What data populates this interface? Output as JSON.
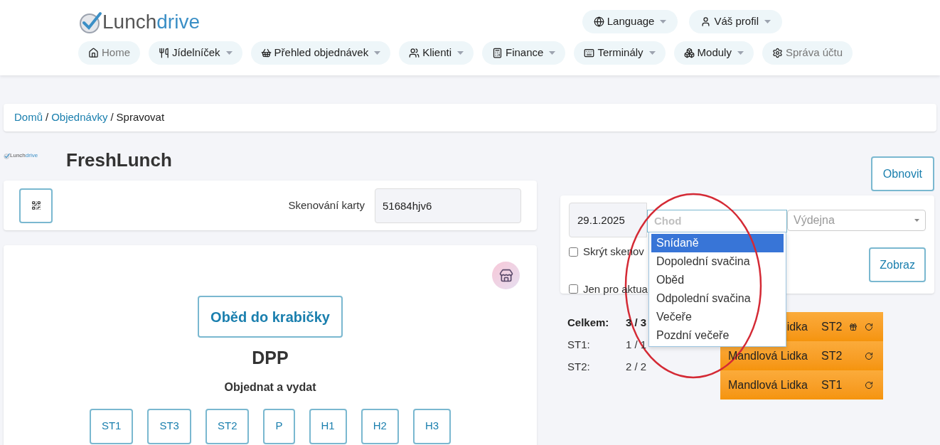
{
  "brand": {
    "part_1": "Lunch",
    "part_2": "drive"
  },
  "top_menu": [
    {
      "label": "Language"
    },
    {
      "label": "Váš profil"
    }
  ],
  "nav": [
    {
      "label": "Home",
      "dropdown": false,
      "muted": true
    },
    {
      "label": "Jídelníček",
      "dropdown": true,
      "muted": false
    },
    {
      "label": "Přehled objednávek",
      "dropdown": true,
      "muted": false
    },
    {
      "label": "Klienti",
      "dropdown": true,
      "muted": false
    },
    {
      "label": "Finance",
      "dropdown": true,
      "muted": false
    },
    {
      "label": "Terminály",
      "dropdown": true,
      "muted": false
    },
    {
      "label": "Moduly",
      "dropdown": true,
      "muted": false
    },
    {
      "label": "Správa účtu",
      "dropdown": false,
      "muted": true
    }
  ],
  "breadcrumb": {
    "separator": "/",
    "items": [
      {
        "label": "Domů",
        "link": true
      },
      {
        "label": "Objednávky",
        "link": true
      },
      {
        "label": "Spravovat",
        "link": false
      }
    ]
  },
  "small_brand": {
    "part_1": "Lunch",
    "part_2": "drive"
  },
  "page_title": "FreshLunch",
  "scan": {
    "label": "Skenování karty",
    "value": "51684hjv6"
  },
  "meal_card": {
    "box_button": "Oběd do krabičky",
    "title": "DPP",
    "subtitle": "Objednat a vydat",
    "stations": [
      "ST1",
      "ST3",
      "ST2",
      "P",
      "H1",
      "H2",
      "H3"
    ]
  },
  "refresh_button": "Obnovit",
  "filters": {
    "date": "29.1.2025",
    "course": {
      "placeholder": "Chod",
      "options": [
        {
          "label": "Snídaně",
          "selected": true
        },
        {
          "label": "Dopolední svačina",
          "selected": false
        },
        {
          "label": "Oběd",
          "selected": false
        },
        {
          "label": "Odpolední svačina",
          "selected": false
        },
        {
          "label": "Večeře",
          "selected": false
        },
        {
          "label": "Pozdní večeře",
          "selected": false
        }
      ]
    },
    "outlet": {
      "placeholder": "Výdejna"
    },
    "checkboxes": [
      {
        "label": "Skrýt skenov",
        "checked": false
      },
      {
        "label": "Jen pro aktua",
        "checked": false
      }
    ],
    "show_button": "Zobraz"
  },
  "stats": [
    {
      "label": "Celkem:",
      "value": "3 / 3",
      "bold": true
    },
    {
      "label": "ST1:",
      "value": "1 / 1",
      "bold": false
    },
    {
      "label": "ST2:",
      "value": "2 / 2",
      "bold": false
    }
  ],
  "orders": [
    {
      "name": "idka",
      "station": "ST2",
      "gift": true
    },
    {
      "name": "Mandlová Lidka",
      "station": "ST2",
      "gift": false
    },
    {
      "name": "Mandlová Lidka",
      "station": "ST1",
      "gift": false
    }
  ]
}
